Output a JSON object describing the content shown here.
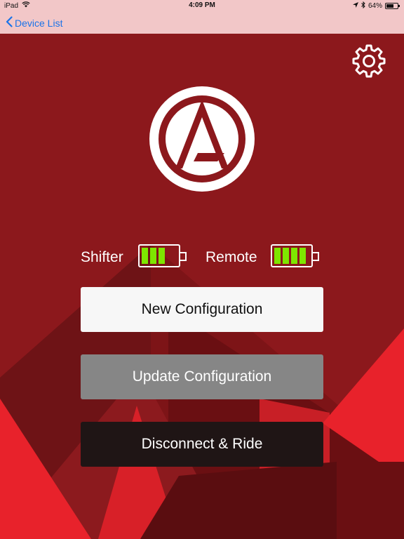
{
  "status_bar": {
    "device": "iPad",
    "time": "4:09 PM",
    "battery_percent": "64%",
    "battery_level": 0.64
  },
  "nav": {
    "back_label": "Device List"
  },
  "batteries": {
    "shifter_label": "Shifter",
    "shifter_cells": 3,
    "remote_label": "Remote",
    "remote_cells": 4
  },
  "buttons": {
    "new_configuration": "New Configuration",
    "update_configuration": "Update Configuration",
    "disconnect_ride": "Disconnect & Ride"
  },
  "colors": {
    "background": "#8c181c",
    "accent_red": "#e8222b",
    "battery_green": "#7ee600",
    "link_blue": "#1a73e8"
  }
}
